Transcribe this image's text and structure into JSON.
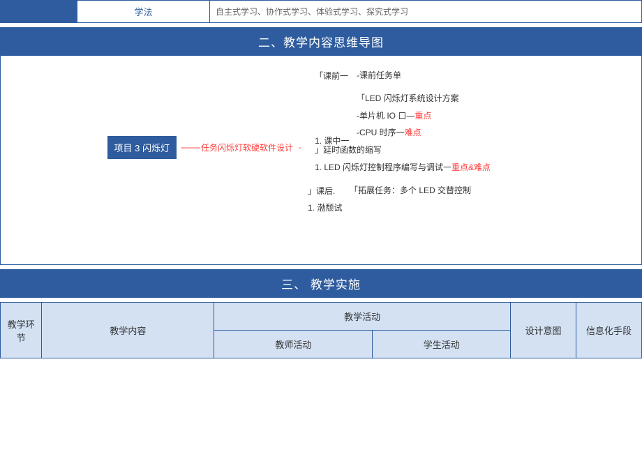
{
  "topRow": {
    "label": "学法",
    "content": "自主式学习、协作式学习、体验式学习、探究式学习"
  },
  "section2": {
    "title": "二、教学内容思维导图"
  },
  "mindmap": {
    "projectBox": "项目 3 闪烁灯",
    "taskLabel": "任务闪烁灯软硬软件设计",
    "phase1": {
      "label": "「课前一",
      "item1": "-课前任务单"
    },
    "phase2": {
      "label": "1. 课中一",
      "item1": "「LED 闪烁灯系统设计方案",
      "item2a": "-单片机 IO 口—",
      "item2b": "重点",
      "item3a": "-CPU 时序一",
      "item3b": "难点",
      "item4": "」延时函数的缩写",
      "item5a": "1. LED 闪烁灯控制程序编写与调试一",
      "item5b": "重点&难点"
    },
    "phase3": {
      "label": "」课后.",
      "item1": "「拓展任务：多个 LED 交替控制",
      "item2": "1. 渤颓试"
    }
  },
  "section3": {
    "title": "三、 教学实施"
  },
  "table": {
    "headers": {
      "stage": "教学环节",
      "content": "教学内容",
      "activity": "教学活动",
      "teacher": "教师活动",
      "student": "学生活动",
      "design": "设计意图",
      "info": "信息化手段"
    }
  }
}
